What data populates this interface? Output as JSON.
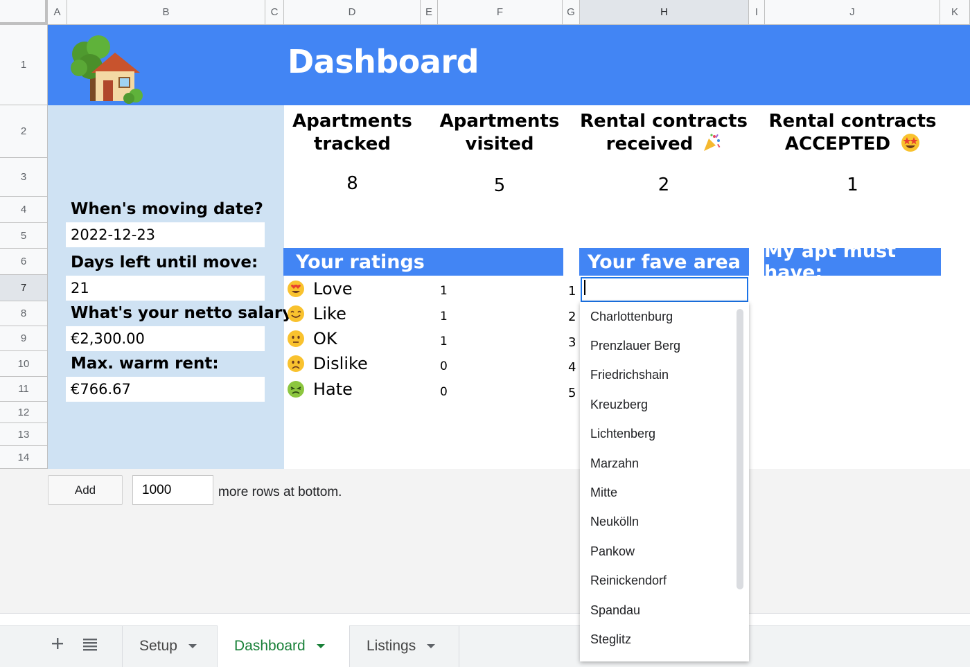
{
  "columns": [
    "A",
    "B",
    "C",
    "D",
    "E",
    "F",
    "G",
    "H",
    "I",
    "J",
    "K"
  ],
  "rows": [
    "1",
    "2",
    "3",
    "4",
    "5",
    "6",
    "7",
    "8",
    "9",
    "10",
    "11",
    "12",
    "13",
    "14"
  ],
  "selected_column": "H",
  "selected_row": "7",
  "dashboard": {
    "title": "Dashboard",
    "logo_icon": "house-with-tree-icon",
    "banner_color": "#4285f4",
    "panel_color": "#cfe2f3"
  },
  "left_panel": {
    "moving_date_label": "When's moving date?",
    "moving_date_value": "2022-12-23",
    "days_left_label": "Days left until move:",
    "days_left_value": "21",
    "salary_label": "What's your netto salary?",
    "salary_value": "€2,300.00",
    "max_rent_label": "Max. warm rent:",
    "max_rent_value": "€766.67"
  },
  "stats": {
    "tracked": {
      "line1": "Apartments",
      "line2": "tracked",
      "value": "8"
    },
    "visited": {
      "line1": "Apartments",
      "line2": "visited",
      "value": "5"
    },
    "received": {
      "line1": "Rental contracts",
      "line2": "received",
      "emoji": "party-popper-icon",
      "value": "2"
    },
    "accepted": {
      "line1": "Rental contracts",
      "line2": "ACCEPTED",
      "emoji": "star-struck-icon",
      "value": "1"
    }
  },
  "ratings": {
    "header": "Your ratings",
    "items": [
      {
        "label": "Love",
        "count": "1",
        "num": "1",
        "icon": "heart-eyes-icon"
      },
      {
        "label": "Like",
        "count": "1",
        "num": "2",
        "icon": "smiling-face-icon"
      },
      {
        "label": "OK",
        "count": "1",
        "num": "3",
        "icon": "neutral-face-icon"
      },
      {
        "label": "Dislike",
        "count": "0",
        "num": "4",
        "icon": "frowning-face-icon"
      },
      {
        "label": "Hate",
        "count": "0",
        "num": "5",
        "icon": "nauseated-face-icon"
      }
    ]
  },
  "fave_area": {
    "header": "Your fave area",
    "input_value": "",
    "options": [
      "Charlottenburg",
      "Prenzlauer Berg",
      "Friedrichshain",
      "Kreuzberg",
      "Lichtenberg",
      "Marzahn",
      "Mitte",
      "Neukölln",
      "Pankow",
      "Reinickendorf",
      "Spandau",
      "Steglitz"
    ]
  },
  "must_have": {
    "header": "My apt must have:"
  },
  "add_rows": {
    "button_label": "Add",
    "count_value": "1000",
    "suffix": "more rows at bottom."
  },
  "sheet_tabs": {
    "add_icon": "plus-icon",
    "list_icon": "all-sheets-icon",
    "tabs": [
      {
        "label": "Setup",
        "active": false
      },
      {
        "label": "Dashboard",
        "active": true
      },
      {
        "label": "Listings",
        "active": false
      }
    ]
  }
}
